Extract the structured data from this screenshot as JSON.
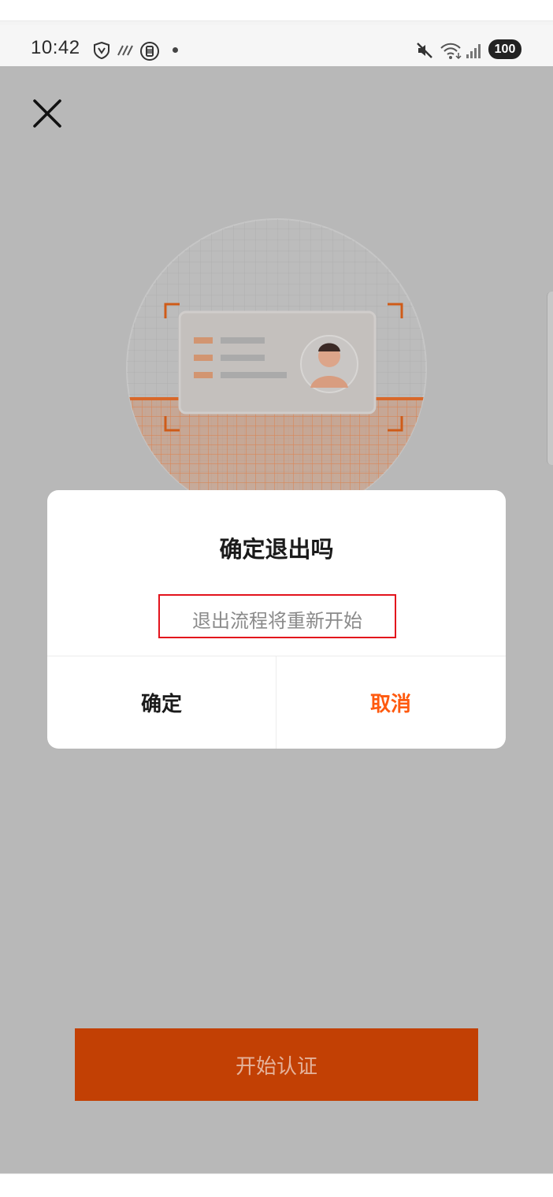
{
  "status_bar": {
    "time": "10:42",
    "battery": "100",
    "icons": [
      "shield-icon",
      "wifi-calling-icon",
      "sim-icon",
      "dot-icon",
      "mute-icon",
      "wifi-icon",
      "signal-icon",
      "battery-icon"
    ]
  },
  "header": {
    "close_icon": "close-icon"
  },
  "dialog": {
    "title": "确定退出吗",
    "message": "退出流程将重新开始",
    "confirm_label": "确定",
    "cancel_label": "取消"
  },
  "footer": {
    "start_label": "开始认证"
  },
  "colors": {
    "accent": "#ff5a0f",
    "primary_button": "#c24004",
    "overlay": "#b8b8b8",
    "highlight_border": "#e3131c"
  }
}
